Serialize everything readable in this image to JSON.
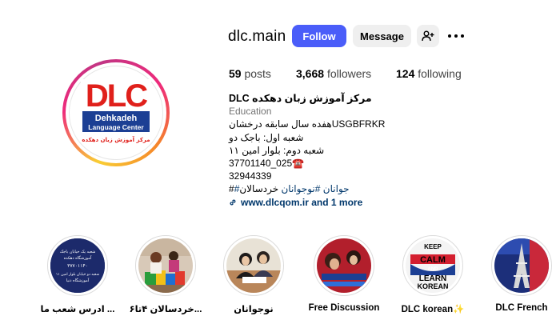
{
  "profile": {
    "username": "dlc.main",
    "logo_text": {
      "mark": "DLC",
      "line1": "Dehkadeh",
      "line2": "Language Center",
      "line3": "مرکز آموزش زبان دهکده"
    }
  },
  "actions": {
    "follow_label": "Follow",
    "message_label": "Message",
    "add_user_icon": "person-plus-icon",
    "more_icon": "more-horizontal-icon"
  },
  "stats": [
    {
      "value": "59",
      "label": "posts"
    },
    {
      "value": "3,668",
      "label": "followers"
    },
    {
      "value": "124",
      "label": "following"
    }
  ],
  "bio": {
    "name": "DLC مرکز آموزش زبان دهکده",
    "category": "Education",
    "line1": "هفده سال سابقه درخشانUSGBFRKR",
    "line2": "شعبه اول: باجک دو",
    "line3": "شعبه دوم: بلوار امین ۱۱",
    "phone1": "37701140_025☎️",
    "phone2": "32944339",
    "hashtags_prefix": "خردسالان",
    "hashtag1": "#نوجوانان",
    "hashtag2": "#جوانان",
    "hashtag_suffix": "#",
    "link": "www.dlcqom.ir and 1 more"
  },
  "highlights": [
    {
      "label": "ادرس شعب ما ...",
      "text1": "شعبه یک خیابان باجک",
      "text2": "آموزشگاه دهکده",
      "text3": "۳۷۷۰۱۱۴۰",
      "text4": "شعبه دو خیابان بلوار امین ۱۱",
      "text5": "آموزشگاه دنیا"
    },
    {
      "label": "خردسالان ۴تا۶..."
    },
    {
      "label": "نوجوانان"
    },
    {
      "label": "Free Discussion"
    },
    {
      "label": "DLC korean✨",
      "text1": "KEEP",
      "text2": "CALM",
      "text3": "AND",
      "text4": "LEARN",
      "text5": "KOREAN"
    },
    {
      "label": "DLC French"
    }
  ],
  "colors": {
    "follow_bg": "#4a5df9",
    "link": "#00376b",
    "dlc_red": "#e0201b",
    "dlc_blue": "#1c3f94"
  }
}
